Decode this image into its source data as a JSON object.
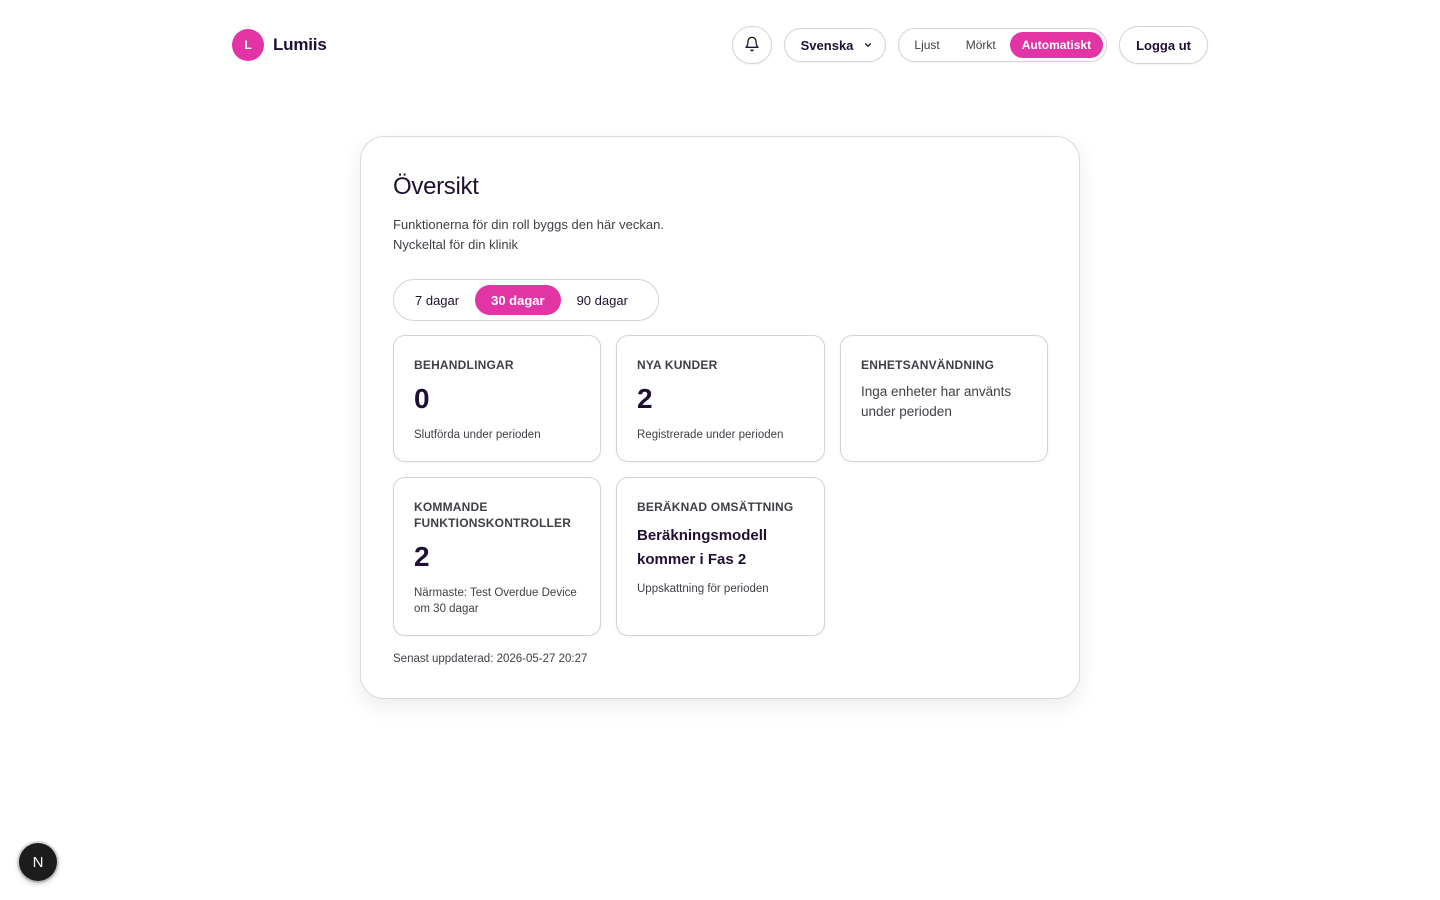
{
  "brand": {
    "initial": "L",
    "name": "Lumiis",
    "color": "#e234a4"
  },
  "header": {
    "notifications_icon": "bell-icon",
    "language": {
      "selected": "Svenska",
      "icon": "chevron-down-icon"
    },
    "theme": {
      "options": [
        "Ljust",
        "Mörkt",
        "Automatiskt"
      ],
      "active": "Automatiskt"
    },
    "logout_label": "Logga ut"
  },
  "overview": {
    "title": "Översikt",
    "subtitle_1": "Funktionerna för din roll byggs den här veckan.",
    "subtitle_2": "Nyckeltal för din klinik",
    "ranges": [
      "7 dagar",
      "30 dagar",
      "90 dagar"
    ],
    "active_range": "30 dagar",
    "stats": {
      "treatments": {
        "label": "BEHANDLINGAR",
        "value": "0",
        "note": "Slutförda under perioden"
      },
      "new_customers": {
        "label": "NYA KUNDER",
        "value": "2",
        "note": "Registrerade under perioden"
      },
      "device_usage": {
        "label": "ENHETSANVÄNDNING",
        "text": "Inga enheter har använts under perioden"
      },
      "upcoming_checks": {
        "label": "KOMMANDE FUNKTIONSKONTROLLER",
        "value": "2",
        "note": "Närmaste: Test Overdue Device om 30 dagar"
      },
      "revenue": {
        "label": "BERÄKNAD OMSÄTTNING",
        "headline": "Beräkningsmodell kommer i Fas 2",
        "note": "Uppskattning för perioden"
      }
    },
    "last_updated": "Senast uppdaterad: 2026-05-27 20:27"
  },
  "dev_badge": {
    "letter": "N"
  }
}
